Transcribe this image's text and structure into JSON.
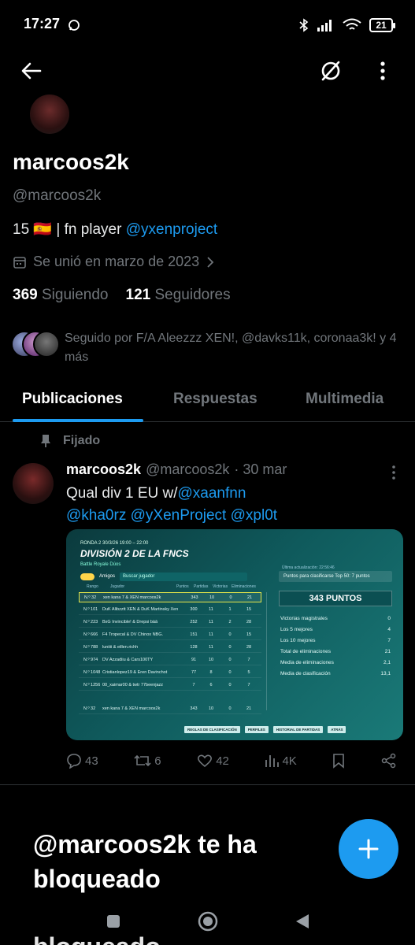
{
  "status_bar": {
    "time": "17:27",
    "battery": "21"
  },
  "colors": {
    "accent": "#1d9bf0",
    "background": "#000000",
    "muted": "#71767b"
  },
  "profile": {
    "display_name": "marcoos2k",
    "handle": "@marcoos2k",
    "bio_prefix": "15 🇪🇸  |  fn player ",
    "bio_link": "@yxenproject",
    "joined": "Se unió en marzo de 2023",
    "following_count": "369",
    "following_label": "Siguiendo",
    "followers_count": "121",
    "followers_label": "Seguidores",
    "followed_by": "Seguido por F/A Aleezzz XEN!, @davks11k, coronaa3k! y 4 más"
  },
  "tabs": [
    {
      "label": "Publicaciones",
      "active": true
    },
    {
      "label": "Respuestas",
      "active": false
    },
    {
      "label": "Multimedia",
      "active": false
    }
  ],
  "tweet": {
    "pinned_label": "Fijado",
    "author_name": "marcoos2k",
    "author_handle": "@marcoos2k",
    "date": "· 30 mar",
    "text_prefix": "Qual div 1 EU w/",
    "mention1": "@xaanfnn",
    "mention2": "@kha0rz",
    "mention3": "@yXenProject",
    "mention4": "@xpl0t",
    "replies": "43",
    "retweets": "6",
    "likes": "42",
    "views": "4K",
    "image": {
      "round": "RONDA 2    30/3/26 19:00 – 22:00",
      "title": "DIVISIÓN 2 DE LA FNCS",
      "subtitle": "Battle Royale  Dúos",
      "friends_label": "Amigos",
      "search_placeholder": "Buscar jugador",
      "columns": [
        "Rango",
        "Jugador",
        "Puntos",
        "Partidas",
        "Victorias",
        "Eliminaciones"
      ],
      "rows": [
        {
          "rank": "N.º 32",
          "player": "xen kana 7 & XEN marcoos2k",
          "pts": "343",
          "p": "10",
          "v": "0",
          "e": "21"
        },
        {
          "rank": "N.º 101",
          "player": "DuK Alibzztt XEN & DuK Martinsky Xen",
          "pts": "300",
          "p": "11",
          "v": "1",
          "e": "15"
        },
        {
          "rank": "N.º 223",
          "player": "BxG Invincible! & Drepsi bàā",
          "pts": "252",
          "p": "11",
          "v": "2",
          "e": "28"
        },
        {
          "rank": "N.º 666",
          "player": "F4 Tropecal & DV Chinox NBG.",
          "pts": "151",
          "p": "11",
          "v": "0",
          "e": "15"
        },
        {
          "rank": "N.º 788",
          "player": "luniiii & eillen.richh",
          "pts": "128",
          "p": "11",
          "v": "0",
          "e": "28"
        },
        {
          "rank": "N.º 974",
          "player": "DV Azzadiiu & Cars100TY",
          "pts": "91",
          "p": "10",
          "v": "0",
          "e": "7"
        },
        {
          "rank": "N.º 1048",
          "player": "Cristianlopez19 & Eren Davinchot",
          "pts": "77",
          "p": "8",
          "v": "0",
          "e": "5"
        },
        {
          "rank": "N.º 1256",
          "player": "00_xaimar00 & twtr 77beenjazz",
          "pts": "7",
          "p": "6",
          "v": "0",
          "e": "7"
        }
      ],
      "footer_row": {
        "rank": "N.º 32",
        "player": "xen kana 7 & XEN marcoos2k",
        "pts": "343",
        "p": "10",
        "v": "0",
        "e": "21"
      },
      "update_label": "Última actualización: 22:56:46",
      "qualify_label": "Puntos para clasificarse Top 50: 7 puntos",
      "points_total": "343 PUNTOS",
      "stats": [
        {
          "label": "Victorias magistrales",
          "value": "0"
        },
        {
          "label": "Los 5 mejores",
          "value": "4"
        },
        {
          "label": "Los 10 mejores",
          "value": "7"
        },
        {
          "label": "Total de eliminaciones",
          "value": "21"
        },
        {
          "label": "Media de eliminaciones",
          "value": "2,1"
        },
        {
          "label": "Media de clasificación",
          "value": "13,1"
        }
      ],
      "buttons": [
        "REGLAS DE CLASIFICACIÓN",
        "PERFILES",
        "HISTORIAL DE PARTIDAS",
        "ATRÁS"
      ]
    }
  },
  "blocked_notice": "@marcoos2k te ha bloqueado",
  "blocked_notice_cut": "bloqueado"
}
